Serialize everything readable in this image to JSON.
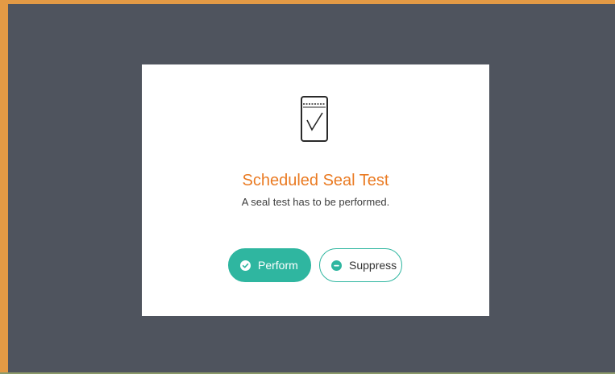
{
  "dialog": {
    "icon": "phone-checkmark-icon",
    "title": "Scheduled Seal Test",
    "message": "A seal test has to be performed."
  },
  "actions": {
    "perform": {
      "label": "Perform",
      "icon": "check-circle-icon"
    },
    "suppress": {
      "label": "Suppress",
      "icon": "minus-circle-icon"
    }
  },
  "colors": {
    "backdrop": "#4f545e",
    "frame_accent": "#e39a45",
    "title": "#ea7b23",
    "primary": "#2fb6a0",
    "text": "#3c3c3c"
  }
}
